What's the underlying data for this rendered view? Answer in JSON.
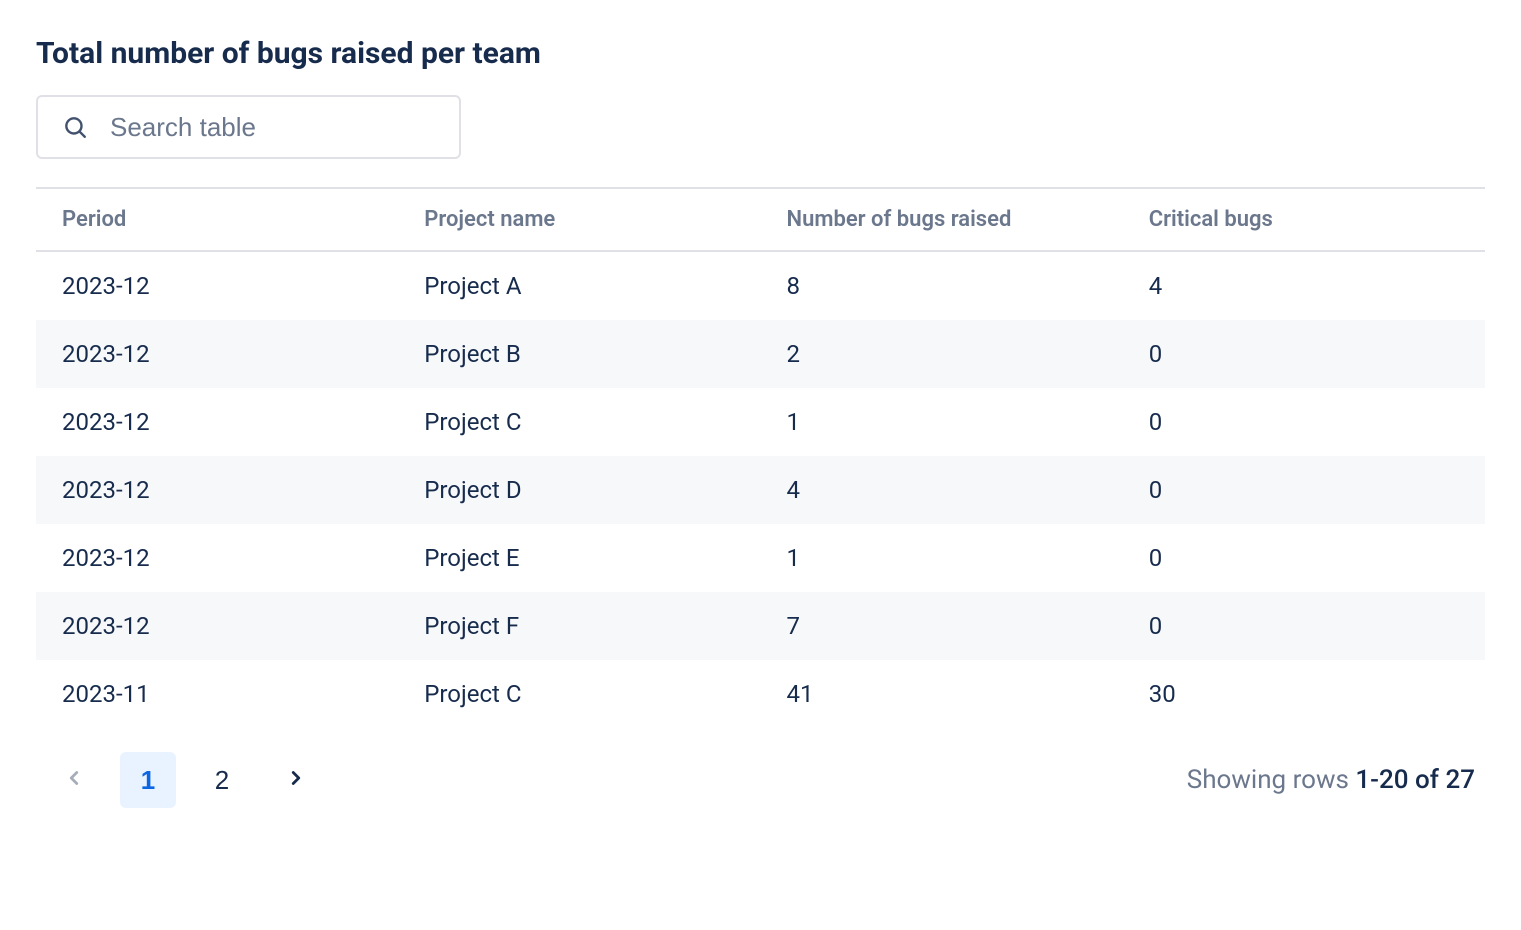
{
  "title": "Total number of bugs raised per team",
  "search": {
    "placeholder": "Search table",
    "value": ""
  },
  "table": {
    "columns": [
      "Period",
      "Project name",
      "Number of bugs raised",
      "Critical bugs"
    ],
    "rows": [
      {
        "period": "2023-12",
        "project": "Project A",
        "bugs": "8",
        "critical": "4"
      },
      {
        "period": "2023-12",
        "project": "Project B",
        "bugs": "2",
        "critical": "0"
      },
      {
        "period": "2023-12",
        "project": "Project C",
        "bugs": "1",
        "critical": "0"
      },
      {
        "period": "2023-12",
        "project": "Project D",
        "bugs": "4",
        "critical": "0"
      },
      {
        "period": "2023-12",
        "project": "Project E",
        "bugs": "1",
        "critical": "0"
      },
      {
        "period": "2023-12",
        "project": "Project F",
        "bugs": "7",
        "critical": "0"
      },
      {
        "period": "2023-11",
        "project": "Project C",
        "bugs": "41",
        "critical": "30"
      }
    ]
  },
  "pagination": {
    "pages": [
      "1",
      "2"
    ],
    "activeIndex": 0,
    "rows_label": "Showing rows ",
    "rows_range": "1-20",
    "rows_mid": " of ",
    "rows_total": "27"
  }
}
